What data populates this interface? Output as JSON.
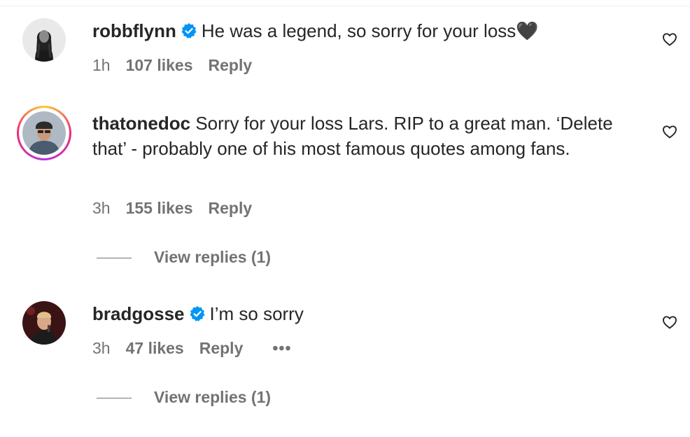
{
  "comments": [
    {
      "username": "robbflynn",
      "verified": true,
      "text": "He was a legend, so sorry for your loss🖤",
      "time": "1h",
      "likes": "107 likes",
      "reply": "Reply"
    },
    {
      "username": "thatonedoc",
      "verified": false,
      "text": "Sorry for your loss Lars. RIP to a great man. ‘Delete that’ - probably one of his most famous quotes among fans.",
      "time": "3h",
      "likes": "155 likes",
      "reply": "Reply",
      "view_replies": "View replies (1)"
    },
    {
      "username": "bradgosse",
      "verified": true,
      "text": "I’m so sorry",
      "time": "3h",
      "likes": "47 likes",
      "reply": "Reply",
      "more": "•••",
      "view_replies": "View replies (1)"
    }
  ],
  "colors": {
    "text": "#262626",
    "secondary": "#737373",
    "verified_badge": "#0095f6"
  },
  "icons": {
    "verified": "verified-badge-icon",
    "like": "heart-outline-icon"
  }
}
